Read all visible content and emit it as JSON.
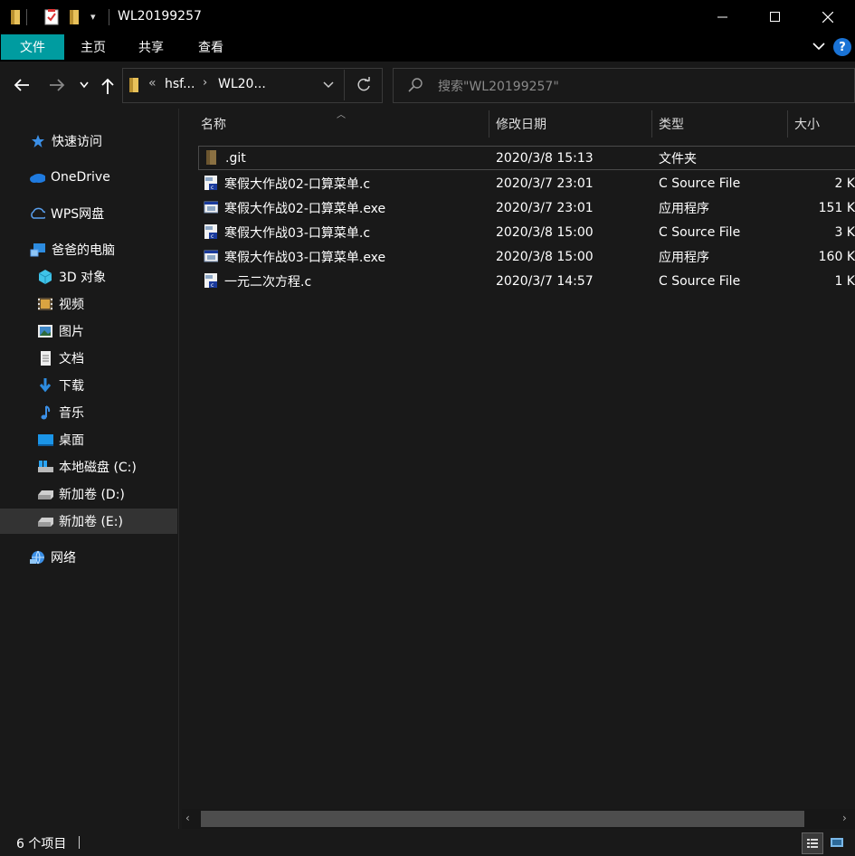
{
  "window": {
    "title": "WL20199257"
  },
  "ribbon": {
    "tabs": [
      "文件",
      "主页",
      "共享",
      "查看"
    ]
  },
  "address": {
    "crumbs": [
      "hsf...",
      "WL20..."
    ],
    "prefix": "«"
  },
  "search": {
    "placeholder": "搜索\"WL20199257\""
  },
  "sidebar": {
    "items": [
      {
        "label": "快速访问",
        "icon": "star-icon"
      },
      {
        "label": "OneDrive",
        "icon": "cloud-icon"
      },
      {
        "label": "WPS网盘",
        "icon": "cloud-outline-icon"
      },
      {
        "label": "爸爸的电脑",
        "icon": "computer-icon"
      },
      {
        "label": "3D 对象",
        "icon": "cube-icon"
      },
      {
        "label": "视频",
        "icon": "video-icon"
      },
      {
        "label": "图片",
        "icon": "picture-icon"
      },
      {
        "label": "文档",
        "icon": "document-icon"
      },
      {
        "label": "下载",
        "icon": "download-icon"
      },
      {
        "label": "音乐",
        "icon": "music-icon"
      },
      {
        "label": "桌面",
        "icon": "desktop-icon"
      },
      {
        "label": "本地磁盘 (C:)",
        "icon": "drive-c-icon"
      },
      {
        "label": "新加卷 (D:)",
        "icon": "drive-icon"
      },
      {
        "label": "新加卷 (E:)",
        "icon": "drive-icon"
      },
      {
        "label": "网络",
        "icon": "network-icon"
      }
    ]
  },
  "columns": {
    "name": "名称",
    "date": "修改日期",
    "type": "类型",
    "size": "大小"
  },
  "files": [
    {
      "name": ".git",
      "date": "2020/3/8 15:13",
      "type": "文件夹",
      "size": "",
      "icon": "folder-icon"
    },
    {
      "name": "寒假大作战02-口算菜单.c",
      "date": "2020/3/7 23:01",
      "type": "C Source File",
      "size": "2 K",
      "icon": "c-file-icon"
    },
    {
      "name": "寒假大作战02-口算菜单.exe",
      "date": "2020/3/7 23:01",
      "type": "应用程序",
      "size": "151 K",
      "icon": "exe-icon"
    },
    {
      "name": "寒假大作战03-口算菜单.c",
      "date": "2020/3/8 15:00",
      "type": "C Source File",
      "size": "3 K",
      "icon": "c-file-icon"
    },
    {
      "name": "寒假大作战03-口算菜单.exe",
      "date": "2020/3/8 15:00",
      "type": "应用程序",
      "size": "160 K",
      "icon": "exe-icon"
    },
    {
      "name": "一元二次方程.c",
      "date": "2020/3/7 14:57",
      "type": "C Source File",
      "size": "1 K",
      "icon": "c-file-icon"
    }
  ],
  "status": {
    "count": "6 个项目"
  },
  "colors": {
    "accent": "#009ca0",
    "background": "#191919",
    "titlebar": "#000000",
    "selected": "#333333"
  }
}
